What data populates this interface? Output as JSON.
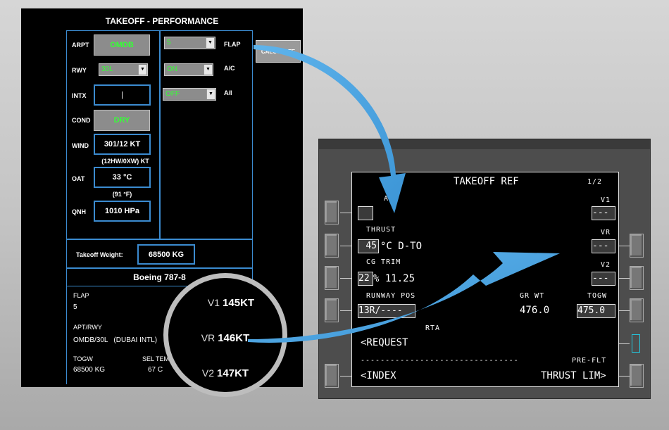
{
  "performance": {
    "title": "TAKEOFF - PERFORMANCE",
    "arpt": {
      "label": "ARPT",
      "value": "OMDB"
    },
    "rwy": {
      "label": "RWY",
      "value": "30L"
    },
    "intx": {
      "label": "INTX",
      "value": "|"
    },
    "cond": {
      "label": "COND",
      "value": "DRY"
    },
    "wind": {
      "label": "WIND",
      "value": "301/12 KT",
      "sub": "(12HW/0XW) KT"
    },
    "oat": {
      "label": "OAT",
      "value": "33 °C",
      "sub": "(91 °F)"
    },
    "qnh": {
      "label": "QNH",
      "value": "1010 HPa"
    },
    "flap": {
      "label": "FLAP",
      "value": "5"
    },
    "ac": {
      "label": "A/C",
      "value": "ON"
    },
    "ai": {
      "label": "A/I",
      "value": "OFF"
    },
    "calculate_label": "CALCULATE",
    "takeoff_weight": {
      "label": "Takeoff Weight:",
      "value": "68500 KG"
    },
    "aircraft": "Boeing 787-8",
    "results": {
      "flap_label": "FLAP",
      "flap_value": "5",
      "aptrwy_label": "APT/RWY",
      "aptrwy_value": "OMDB/30L   (DUBAI INTL)",
      "togw_label": "TOGW",
      "togw_value": "68500 KG",
      "seltemp_label": "SEL TEMP",
      "seltemp_value": "67 C"
    }
  },
  "magnifier": {
    "v1": {
      "label": "V1",
      "value": "145KT"
    },
    "vr": {
      "label": "VR",
      "value": "146KT"
    },
    "v2": {
      "label": "V2",
      "value": "147KT"
    }
  },
  "cdu": {
    "title": "TAKEOFF REF",
    "page": "1/2",
    "flaps_label": "APS",
    "flaps_value": "",
    "thrust_label": "THRUST",
    "thrust_value": "45",
    "thrust_suffix": "°C D-TO",
    "cg_label": "CG TRIM",
    "cg_value": "22",
    "cg_suffix": "% 11.25",
    "runway_label": "RUNWAY POS",
    "runway_value": "13R/----",
    "grwt_label": "GR WT",
    "grwt_value": "476.0",
    "togw_label": "TOGW",
    "togw_value": "475.0",
    "v1_label": "V1",
    "v1_value": "---",
    "vr_label": "VR",
    "vr_value": "---",
    "v2_label": "V2",
    "v2_value": "---",
    "data_label": "RTA",
    "request": "<REQUEST",
    "preflt": "PRE-FLT",
    "index": "<INDEX",
    "thrust_lim": "THRUST LIM>"
  },
  "colors": {
    "accent_blue": "#3b8bd0",
    "value_green": "#36ff36",
    "arrow_blue": "#4aa3df",
    "lsk_cyan": "#22c8e0"
  }
}
